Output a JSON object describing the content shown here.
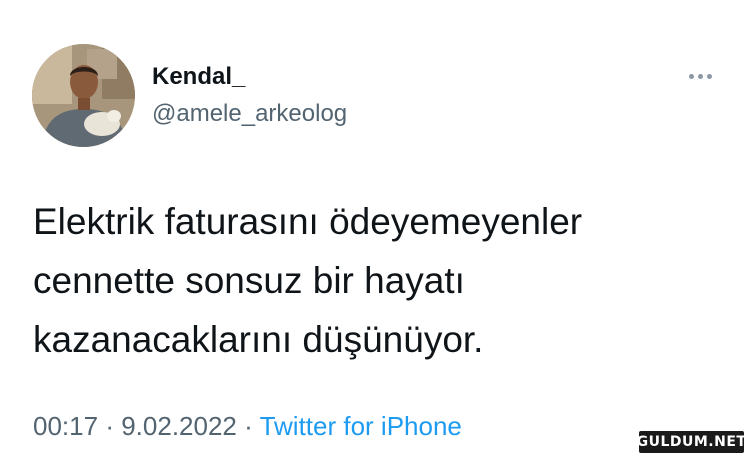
{
  "tweet": {
    "author": {
      "display_name": "Kendal_",
      "handle": "@amele_arkeolog"
    },
    "more_icon": "more-horizontal-icon",
    "text": "Elektrik faturasını ödeyemeyenler cennette sonsuz bir hayatı kazanacaklarını düşünüyor.",
    "time": "00:17",
    "separator": "·",
    "date": "9.02.2022",
    "source": "Twitter for iPhone"
  },
  "watermark": {
    "text": "GULDUM.NET"
  },
  "colors": {
    "text_primary": "#0f1419",
    "text_secondary": "#536471",
    "link": "#1d9bf0"
  }
}
